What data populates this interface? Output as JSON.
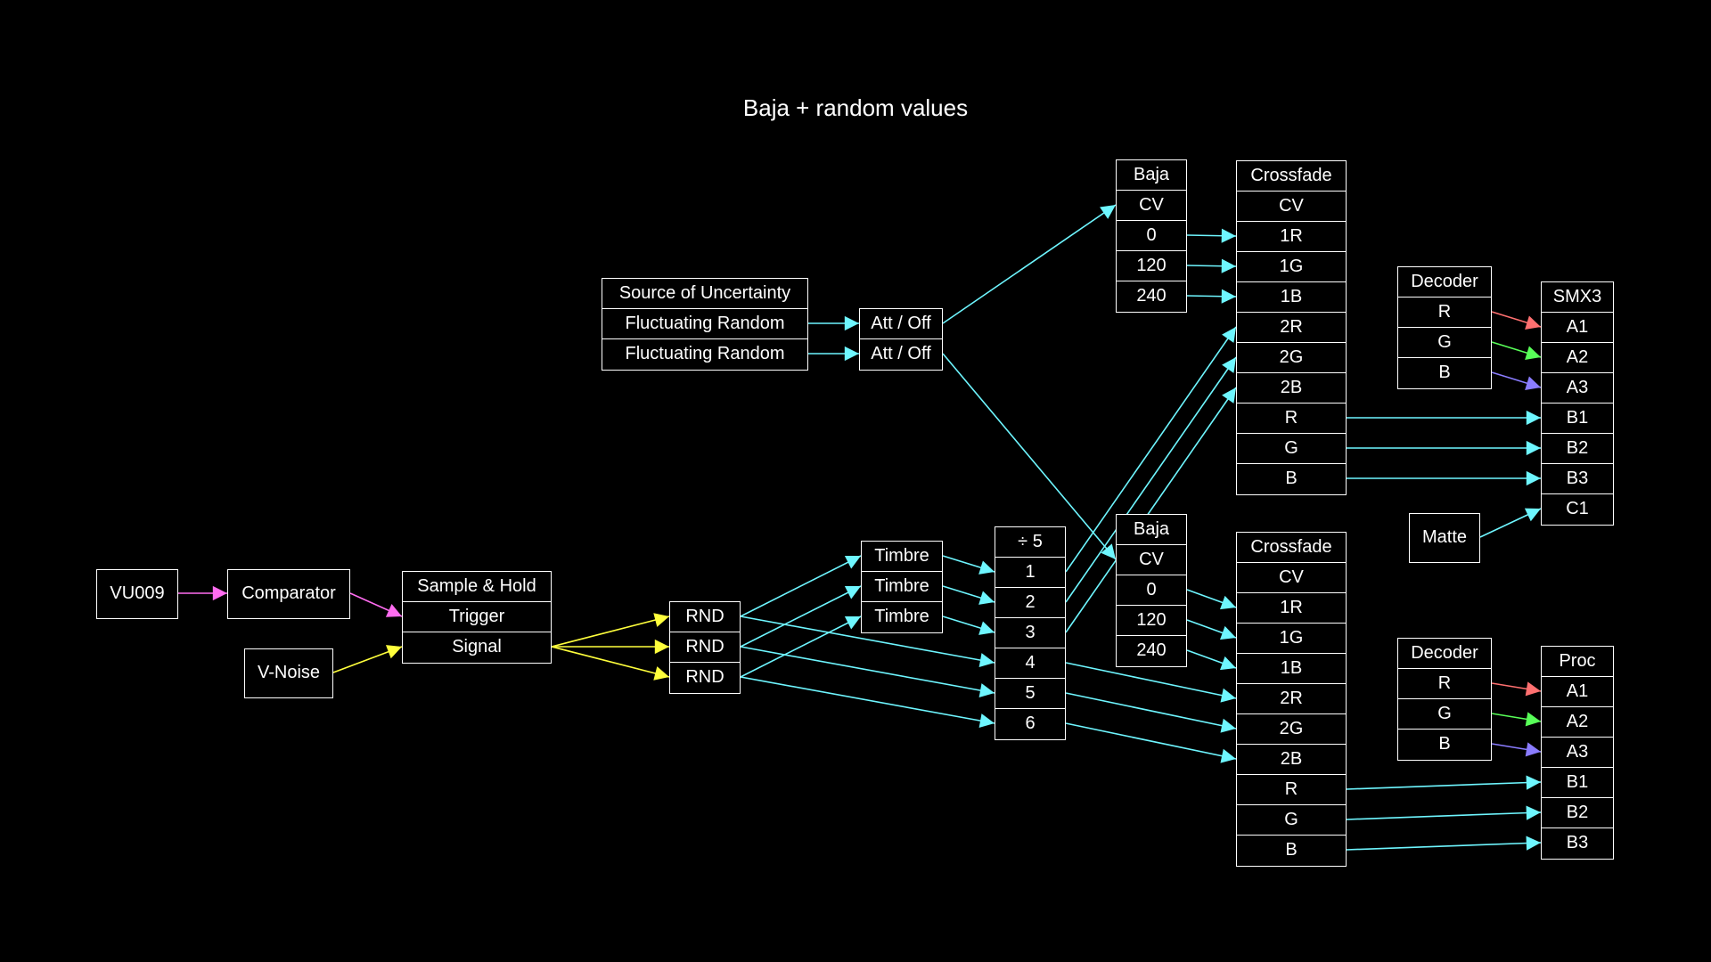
{
  "title": "Baja + random values",
  "colors": {
    "background": "#000000",
    "box_stroke": "#ffffff",
    "text": "#ffffff",
    "wire_magenta": "#ff6cf0",
    "wire_yellow": "#ffff3c",
    "wire_cyan": "#6ef6ff",
    "wire_red": "#ff7070",
    "wire_green": "#58ff58",
    "wire_blue": "#8a7cff"
  },
  "nodes": {
    "vu009": [
      "VU009"
    ],
    "comparator": [
      "Comparator"
    ],
    "vnoise": [
      "V-Noise"
    ],
    "sh": [
      "Sample & Hold",
      "Trigger",
      "Signal"
    ],
    "rnd": [
      "RND",
      "RND",
      "RND"
    ],
    "uncertainty": [
      "Source of Uncertainty",
      "Fluctuating Random",
      "Fluctuating Random"
    ],
    "attoff": [
      "Att / Off",
      "Att / Off"
    ],
    "timbre": [
      "Timbre",
      "Timbre",
      "Timbre"
    ],
    "div5": [
      "÷ 5",
      "1",
      "2",
      "3",
      "4",
      "5",
      "6"
    ],
    "baja1": [
      "Baja",
      "CV",
      "0",
      "120",
      "240"
    ],
    "baja2": [
      "Baja",
      "CV",
      "0",
      "120",
      "240"
    ],
    "xf1": [
      "Crossfade",
      "CV",
      "1R",
      "1G",
      "1B",
      "2R",
      "2G",
      "2B",
      "R",
      "G",
      "B"
    ],
    "xf2": [
      "Crossfade",
      "CV",
      "1R",
      "1G",
      "1B",
      "2R",
      "2G",
      "2B",
      "R",
      "G",
      "B"
    ],
    "dec1": [
      "Decoder",
      "R",
      "G",
      "B"
    ],
    "dec2": [
      "Decoder",
      "R",
      "G",
      "B"
    ],
    "smx3": [
      "SMX3",
      "A1",
      "A2",
      "A3",
      "B1",
      "B2",
      "B3",
      "C1"
    ],
    "proc": [
      "Proc",
      "A1",
      "A2",
      "A3",
      "B1",
      "B2",
      "B3"
    ],
    "matte": [
      "Matte"
    ]
  },
  "connections": [
    {
      "from": "vu009.0",
      "to": "comparator.0",
      "color": "magenta"
    },
    {
      "from": "comparator.0",
      "to": "sh.1",
      "color": "magenta"
    },
    {
      "from": "vnoise.0",
      "to": "sh.2",
      "color": "yellow"
    },
    {
      "from": "sh.2",
      "to": "rnd.0",
      "color": "yellow"
    },
    {
      "from": "sh.2",
      "to": "rnd.1",
      "color": "yellow"
    },
    {
      "from": "sh.2",
      "to": "rnd.2",
      "color": "yellow"
    },
    {
      "from": "rnd.0",
      "to": "timbre.0",
      "color": "cyan"
    },
    {
      "from": "rnd.1",
      "to": "timbre.1",
      "color": "cyan"
    },
    {
      "from": "rnd.2",
      "to": "timbre.2",
      "color": "cyan"
    },
    {
      "from": "rnd.0",
      "to": "div5.4",
      "color": "cyan"
    },
    {
      "from": "rnd.1",
      "to": "div5.5",
      "color": "cyan"
    },
    {
      "from": "rnd.2",
      "to": "div5.6",
      "color": "cyan"
    },
    {
      "from": "timbre.0",
      "to": "div5.1",
      "color": "cyan"
    },
    {
      "from": "timbre.1",
      "to": "div5.2",
      "color": "cyan"
    },
    {
      "from": "timbre.2",
      "to": "div5.3",
      "color": "cyan"
    },
    {
      "from": "uncertainty.1",
      "to": "attoff.0",
      "color": "cyan"
    },
    {
      "from": "uncertainty.2",
      "to": "attoff.1",
      "color": "cyan"
    },
    {
      "from": "attoff.0",
      "to": "baja1.1",
      "color": "cyan"
    },
    {
      "from": "attoff.1",
      "to": "baja2.1",
      "color": "cyan"
    },
    {
      "from": "baja1.2",
      "to": "xf1.2",
      "color": "cyan"
    },
    {
      "from": "baja1.3",
      "to": "xf1.3",
      "color": "cyan"
    },
    {
      "from": "baja1.4",
      "to": "xf1.4",
      "color": "cyan"
    },
    {
      "from": "baja2.2",
      "to": "xf2.2",
      "color": "cyan"
    },
    {
      "from": "baja2.3",
      "to": "xf2.3",
      "color": "cyan"
    },
    {
      "from": "baja2.4",
      "to": "xf2.4",
      "color": "cyan"
    },
    {
      "from": "div5.1",
      "to": "xf1.5",
      "color": "cyan"
    },
    {
      "from": "div5.2",
      "to": "xf1.6",
      "color": "cyan"
    },
    {
      "from": "div5.3",
      "to": "xf1.7",
      "color": "cyan"
    },
    {
      "from": "div5.4",
      "to": "xf2.5",
      "color": "cyan"
    },
    {
      "from": "div5.5",
      "to": "xf2.6",
      "color": "cyan"
    },
    {
      "from": "div5.6",
      "to": "xf2.7",
      "color": "cyan"
    },
    {
      "from": "xf1.8",
      "to": "smx3.4",
      "color": "cyan"
    },
    {
      "from": "xf1.9",
      "to": "smx3.5",
      "color": "cyan"
    },
    {
      "from": "xf1.10",
      "to": "smx3.6",
      "color": "cyan"
    },
    {
      "from": "xf2.8",
      "to": "proc.4",
      "color": "cyan"
    },
    {
      "from": "xf2.9",
      "to": "proc.5",
      "color": "cyan"
    },
    {
      "from": "xf2.10",
      "to": "proc.6",
      "color": "cyan"
    },
    {
      "from": "dec1.1",
      "to": "smx3.1",
      "color": "red"
    },
    {
      "from": "dec1.2",
      "to": "smx3.2",
      "color": "green"
    },
    {
      "from": "dec1.3",
      "to": "smx3.3",
      "color": "blue"
    },
    {
      "from": "dec2.1",
      "to": "proc.1",
      "color": "red"
    },
    {
      "from": "dec2.2",
      "to": "proc.2",
      "color": "green"
    },
    {
      "from": "dec2.3",
      "to": "proc.3",
      "color": "blue"
    },
    {
      "from": "matte.0",
      "to": "smx3.7",
      "color": "cyan"
    }
  ]
}
